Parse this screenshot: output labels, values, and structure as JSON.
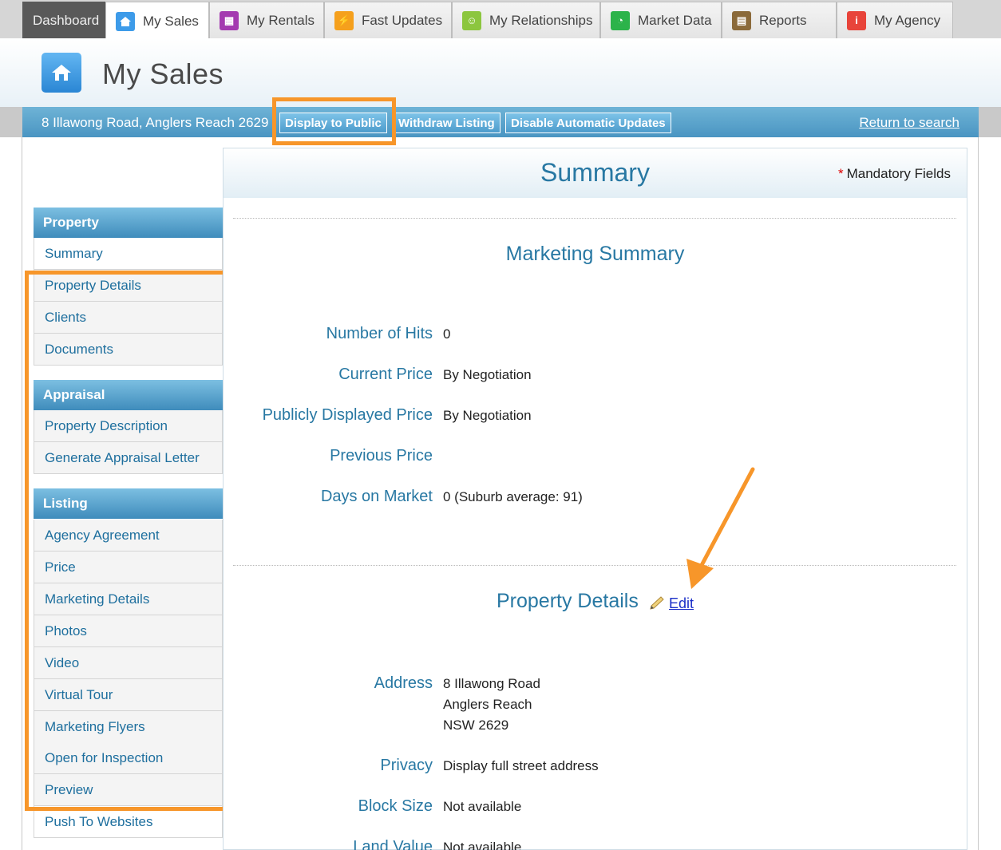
{
  "nav": {
    "tabs": [
      {
        "label": "Dashboard",
        "icon": "dashboard"
      },
      {
        "label": "My Sales",
        "icon": "home-icon",
        "color": "#3d9be9"
      },
      {
        "label": "My Rentals",
        "icon": "building-icon",
        "color": "#a43ab0"
      },
      {
        "label": "Fast Updates",
        "icon": "lightning-icon",
        "color": "#f5a01d"
      },
      {
        "label": "My Relationships",
        "icon": "people-icon",
        "color": "#8cc63f"
      },
      {
        "label": "Market Data",
        "icon": "pie-chart-icon",
        "color": "#2cb34a"
      },
      {
        "label": "Reports",
        "icon": "report-icon",
        "color": "#8b6a3a"
      },
      {
        "label": "My Agency",
        "icon": "person-icon",
        "color": "#e8443a"
      }
    ]
  },
  "header": {
    "title": "My Sales",
    "logo_icon": "home-icon"
  },
  "addressbar": {
    "address": "8 Illawong Road, Anglers Reach 2629",
    "buttons": [
      "Display to Public",
      "Withdraw Listing",
      "Disable Automatic Updates"
    ],
    "return_link": "Return to search"
  },
  "sidebar": {
    "sections": [
      {
        "title": "Property",
        "items": [
          "Summary",
          "Property Details",
          "Clients",
          "Documents"
        ]
      },
      {
        "title": "Appraisal",
        "items": [
          "Property Description",
          "Generate Appraisal Letter"
        ]
      },
      {
        "title": "Listing",
        "items": [
          "Agency Agreement",
          "Price",
          "Marketing Details",
          "Photos",
          "Video",
          "Virtual Tour",
          "Marketing Flyers",
          "Open for Inspection",
          "Preview",
          "Push To Websites"
        ]
      }
    ]
  },
  "main": {
    "title": "Summary",
    "mandatory_star": "*",
    "mandatory": "Mandatory Fields",
    "marketing": {
      "title": "Marketing Summary",
      "rows": [
        {
          "label": "Number of Hits",
          "value": "0"
        },
        {
          "label": "Current Price",
          "value": "By Negotiation"
        },
        {
          "label": "Publicly Displayed Price",
          "value": "By Negotiation"
        },
        {
          "label": "Previous Price",
          "value": ""
        },
        {
          "label": "Days on Market",
          "value": "0 (Suburb average: 91)"
        }
      ]
    },
    "property_details": {
      "title": "Property Details",
      "edit_label": "Edit",
      "address_label": "Address",
      "address_lines": [
        "8 Illawong Road",
        "Anglers Reach",
        "NSW 2629"
      ],
      "rows": [
        {
          "label": "Privacy",
          "value": "Display full street address"
        },
        {
          "label": "Block Size",
          "value": "Not available"
        },
        {
          "label": "Land Value",
          "value": "Not available"
        }
      ]
    }
  },
  "colors": {
    "accent": "#2878a3",
    "highlight": "#f7962a",
    "bar": "#4a95c2"
  }
}
